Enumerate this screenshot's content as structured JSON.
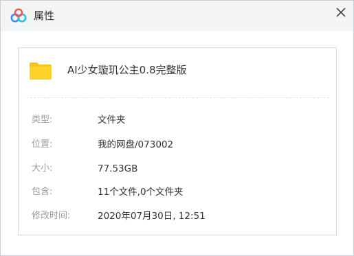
{
  "window": {
    "title": "属性",
    "icons": {
      "app": "baidu-netdisk-cloud-icon",
      "close": "close-icon"
    }
  },
  "file": {
    "name": "AI少女璇玑公主0.8完整版",
    "icon": "folder-icon",
    "folder_color": "#f5c518"
  },
  "properties": [
    {
      "label": "类型:",
      "value": "文件夹"
    },
    {
      "label": "位置:",
      "value": "我的网盘/073002"
    },
    {
      "label": "大小:",
      "value": "77.53GB"
    },
    {
      "label": "包含:",
      "value": "11个文件,0个文件夹"
    },
    {
      "label": "修改时间:",
      "value": "2020年07月30日, 12:51"
    }
  ],
  "colors": {
    "logo_blue": "#3a8ef6",
    "logo_cyan": "#2bc0e4",
    "logo_red": "#ef5a4c"
  }
}
